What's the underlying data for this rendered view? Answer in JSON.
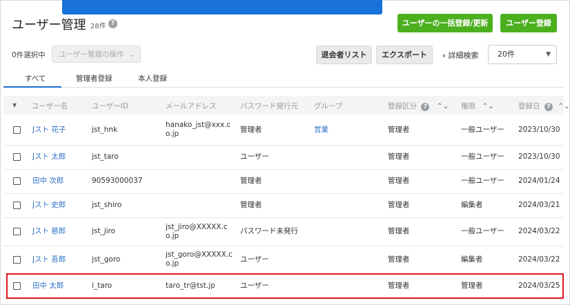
{
  "header": {
    "title": "ユーザー管理",
    "count": "28件",
    "help_icon": "?"
  },
  "actions": {
    "bulk_register": "ユーザーの一括登録/更新",
    "register": "ユーザー登録"
  },
  "toolbar": {
    "selected": "0件選択中",
    "bulk_ops": "ユーザー管理の操作",
    "withdrawn_list": "退会者リスト",
    "export": "エクスポート",
    "advanced_search": "詳細検索",
    "page_size": "20件"
  },
  "tabs": [
    {
      "label": "すべて"
    },
    {
      "label": "管理者登録"
    },
    {
      "label": "本人登録"
    }
  ],
  "columns": {
    "name": "ユーザー名",
    "id": "ユーザーID",
    "email": "メールアドレス",
    "pw_issuer": "パスワード発行元",
    "group": "グループ",
    "reg_type": "登録区分",
    "role": "権限",
    "date": "登録日"
  },
  "rows": [
    {
      "name": "Jスト 花子",
      "id": "jst_hnk",
      "email1": "hanako_jst@xxx.c",
      "email2": "o.jp",
      "pw": "管理者",
      "group": "営業",
      "reg": "管理者",
      "role": "一般ユーザー",
      "date": "2023/10/30"
    },
    {
      "name": "Jスト 太郎",
      "id": "jst_taro",
      "email1": "",
      "email2": "",
      "pw": "ユーザー",
      "group": "",
      "reg": "管理者",
      "role": "一般ユーザー",
      "date": "2023/10/30"
    },
    {
      "name": "田中 次郎",
      "id": "90593000037",
      "email1": "",
      "email2": "",
      "pw": "管理者",
      "group": "",
      "reg": "管理者",
      "role": "一般ユーザー",
      "date": "2024/01/24"
    },
    {
      "name": "Jスト 史郎",
      "id": "jst_shiro",
      "email1": "",
      "email2": "",
      "pw": "管理者",
      "group": "",
      "reg": "管理者",
      "role": "編集者",
      "date": "2024/03/21"
    },
    {
      "name": "Jスト 慈郎",
      "id": "jst_jiro",
      "email1": "jst_jiro@XXXXX.c",
      "email2": "o.jp",
      "pw": "パスワード未発行",
      "group": "",
      "reg": "管理者",
      "role": "一般ユーザー",
      "date": "2024/03/22"
    },
    {
      "name": "Jスト 吾郎",
      "id": "jst_goro",
      "email1": "jst_goro@XXXXX.c",
      "email2": "o.jp",
      "pw": "ユーザー",
      "group": "",
      "reg": "管理者",
      "role": "編集者",
      "date": "2024/03/22"
    },
    {
      "name": "田中 太郎",
      "id": "i_taro",
      "email1": "taro_tr@tst.jp",
      "email2": "",
      "pw": "ユーザー",
      "group": "",
      "reg": "管理者",
      "role": "管理者",
      "date": "2024/03/25"
    }
  ],
  "colors": {
    "accent_green": "#4caf1e",
    "link_blue": "#2a6fc9",
    "highlight_red": "#e0161e"
  }
}
